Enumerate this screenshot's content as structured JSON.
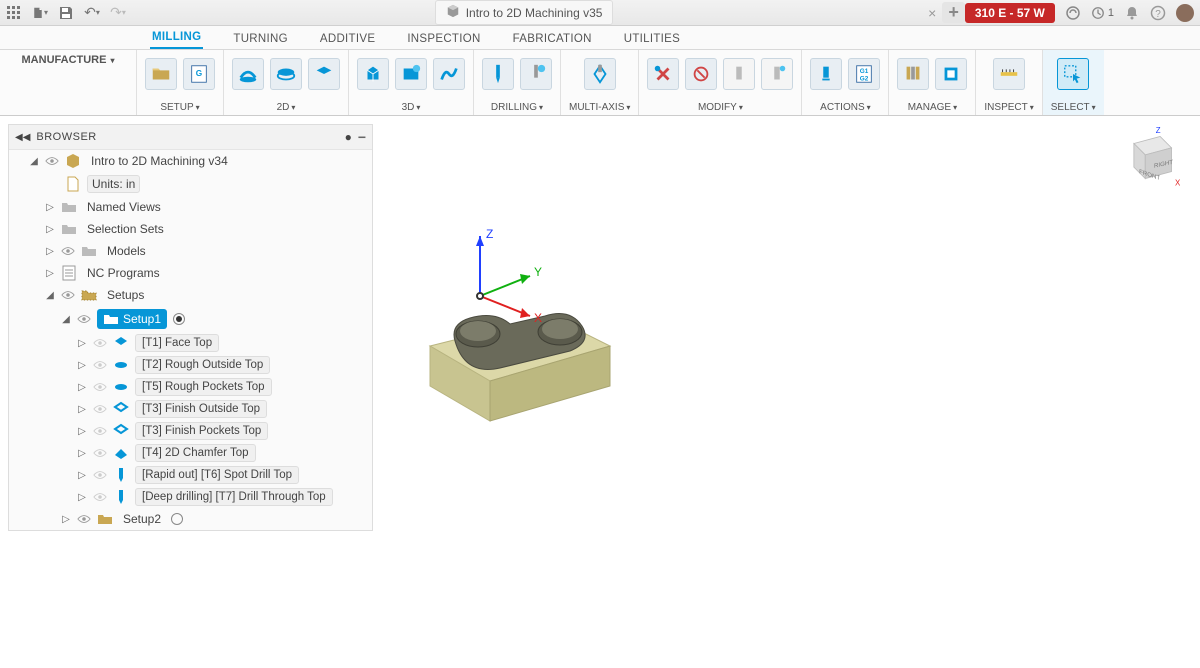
{
  "titlebar": {
    "doc_title": "Intro to 2D Machining v35",
    "credits": "310 E - 57 W",
    "notif_count": "1"
  },
  "tabs": [
    "MILLING",
    "TURNING",
    "ADDITIVE",
    "INSPECTION",
    "FABRICATION",
    "UTILITIES"
  ],
  "ribbon": {
    "workspace": "MANUFACTURE",
    "groups": [
      "SETUP",
      "2D",
      "3D",
      "DRILLING",
      "MULTI-AXIS",
      "MODIFY",
      "ACTIONS",
      "MANAGE",
      "INSPECT",
      "SELECT"
    ]
  },
  "browser": {
    "title": "BROWSER",
    "root": "Intro to 2D Machining v34",
    "units": "Units: in",
    "nodes": {
      "named_views": "Named Views",
      "selection_sets": "Selection Sets",
      "models": "Models",
      "nc_programs": "NC Programs",
      "setups": "Setups",
      "setup1": "Setup1",
      "setup2": "Setup2"
    },
    "ops": [
      "[T1] Face Top",
      "[T2] Rough Outside Top",
      "[T5] Rough Pockets Top",
      "[T3] Finish Outside Top",
      "[T3] Finish Pockets Top",
      "[T4] 2D Chamfer Top",
      "[Rapid out] [T6] Spot Drill Top",
      "[Deep drilling] [T7] Drill Through Top"
    ]
  },
  "viewcube": {
    "front": "FRONT",
    "right": "RIGHT",
    "axis_x": "X",
    "axis_y": "Y",
    "axis_z": "Z"
  }
}
